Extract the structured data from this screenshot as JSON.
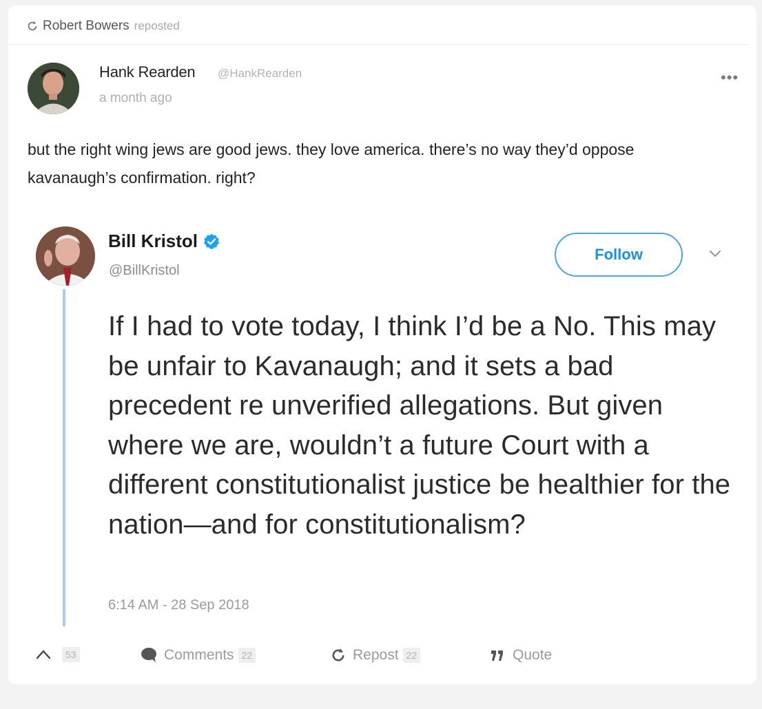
{
  "repost": {
    "reposter": "Robert Bowers",
    "action": "reposted",
    "icon": "repost-icon"
  },
  "post": {
    "author_name": "Hank Rearden",
    "author_handle": "@HankRearden",
    "timestamp": "a month ago",
    "menu_label": "•••",
    "text": "but the right wing jews are good jews. they love america. there’s no way they’d oppose kavanaugh’s confirmation. right?"
  },
  "embedded_tweet": {
    "name": "Bill Kristol",
    "handle": "@BillKristol",
    "follow_label": "Follow",
    "text": "If I had to vote today, I think I’d be a No. This may be unfair to Kavanaugh; and it sets a bad precedent re unverified allegations. But given where we are, wouldn’t a future Court with a different constitutionalist justice be healthier for the nation—and for constitutionalism?",
    "time": "6:14 AM - 28 Sep 2018",
    "accent_color": "#1d8fe1"
  },
  "actions": {
    "upvote_count": "53",
    "comments_label": "Comments",
    "comments_count": "22",
    "repost_label": "Repost",
    "repost_count": "22",
    "quote_label": "Quote"
  }
}
